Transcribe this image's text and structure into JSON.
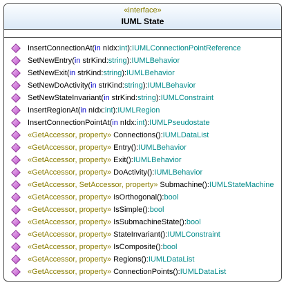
{
  "interface": {
    "stereotype": "«interface»",
    "name": "IUML State"
  },
  "operations": [
    {
      "stereo": "",
      "name": "InsertConnectionAt(",
      "kw": "in",
      "param": " nIdx:",
      "ptype": "int",
      "close": "):",
      "ret": "IUMLConnectionPointReference"
    },
    {
      "stereo": "",
      "name": "SetNewEntry(",
      "kw": "in",
      "param": " strKind:",
      "ptype": "string",
      "close": "):",
      "ret": "IUMLBehavior"
    },
    {
      "stereo": "",
      "name": "SetNewExit(",
      "kw": "in",
      "param": " strKind:",
      "ptype": "string",
      "close": "):",
      "ret": "IUMLBehavior"
    },
    {
      "stereo": "",
      "name": "SetNewDoActivity(",
      "kw": "in",
      "param": " strKind:",
      "ptype": "string",
      "close": "):",
      "ret": "IUMLBehavior"
    },
    {
      "stereo": "",
      "name": "SetNewStateInvariant(",
      "kw": "in",
      "param": " strKind:",
      "ptype": "string",
      "close": "):",
      "ret": "IUMLConstraint"
    },
    {
      "stereo": "",
      "name": "InsertRegionAt(",
      "kw": "in",
      "param": " nIdx:",
      "ptype": "int",
      "close": "):",
      "ret": "IUMLRegion"
    },
    {
      "stereo": "",
      "name": "InsertConnectionPointAt(",
      "kw": "in",
      "param": " nIdx:",
      "ptype": "int",
      "close": "):",
      "ret": "IUMLPseudostate"
    },
    {
      "stereo": "«GetAccessor, property»",
      "name": " Connections():",
      "kw": "",
      "param": "",
      "ptype": "",
      "close": "",
      "ret": "IUMLDataList"
    },
    {
      "stereo": "«GetAccessor, property»",
      "name": " Entry():",
      "kw": "",
      "param": "",
      "ptype": "",
      "close": "",
      "ret": "IUMLBehavior"
    },
    {
      "stereo": "«GetAccessor, property»",
      "name": " Exit():",
      "kw": "",
      "param": "",
      "ptype": "",
      "close": "",
      "ret": "IUMLBehavior"
    },
    {
      "stereo": "«GetAccessor, property»",
      "name": " DoActivity():",
      "kw": "",
      "param": "",
      "ptype": "",
      "close": "",
      "ret": "IUMLBehavior"
    },
    {
      "stereo": "«GetAccessor, SetAccessor, property»",
      "name": " Submachine():",
      "kw": "",
      "param": "",
      "ptype": "",
      "close": "",
      "ret": "IUMLStateMachine"
    },
    {
      "stereo": "«GetAccessor, property»",
      "name": " IsOrthogonal():",
      "kw": "",
      "param": "",
      "ptype": "",
      "close": "",
      "ret": "bool"
    },
    {
      "stereo": "«GetAccessor, property»",
      "name": " IsSimple():",
      "kw": "",
      "param": "",
      "ptype": "",
      "close": "",
      "ret": "bool"
    },
    {
      "stereo": "«GetAccessor, property»",
      "name": " IsSubmachineState():",
      "kw": "",
      "param": "",
      "ptype": "",
      "close": "",
      "ret": "bool"
    },
    {
      "stereo": "«GetAccessor, property»",
      "name": " StateInvariant():",
      "kw": "",
      "param": "",
      "ptype": "",
      "close": "",
      "ret": "IUMLConstraint"
    },
    {
      "stereo": "«GetAccessor, property»",
      "name": " IsComposite():",
      "kw": "",
      "param": "",
      "ptype": "",
      "close": "",
      "ret": "bool"
    },
    {
      "stereo": "«GetAccessor, property»",
      "name": " Regions():",
      "kw": "",
      "param": "",
      "ptype": "",
      "close": "",
      "ret": "IUMLDataList"
    },
    {
      "stereo": "«GetAccessor, property»",
      "name": " ConnectionPoints():",
      "kw": "",
      "param": "",
      "ptype": "",
      "close": "",
      "ret": "IUMLDataList"
    }
  ],
  "icon": "public-operation-icon",
  "colors": {
    "stereotype": "#8a7d00",
    "keyword": "#0000c8",
    "type": "#008a8a",
    "icon_fill": "#d77be0"
  }
}
